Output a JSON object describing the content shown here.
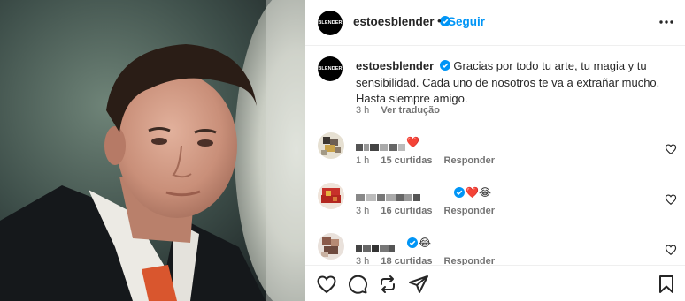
{
  "post": {
    "username": "estoesblender",
    "avatar_text": "BLENDER",
    "follow_label": "Seguir",
    "separator": "•",
    "verified": true
  },
  "caption": {
    "username": "estoesblender",
    "text": "Gracias por todo tu arte, tu magia y tu sensibilidad. Cada uno de nosotros te va a extrañar mucho. Hasta siempre amigo.",
    "time": "3 h",
    "translate_label": "Ver tradução"
  },
  "comments": [
    {
      "time": "1 h",
      "likes": "15 curtidas",
      "reply": "Responder",
      "emojis": "❤️",
      "verified": false
    },
    {
      "time": "3 h",
      "likes": "16 curtidas",
      "reply": "Responder",
      "emojis": "❤️😂",
      "verified": true
    },
    {
      "time": "3 h",
      "likes": "18 curtidas",
      "reply": "Responder",
      "emojis": "😂",
      "verified": true
    }
  ],
  "colors": {
    "accent": "#0095f6",
    "text": "#262626",
    "muted": "#737373",
    "heart": "#ff3040"
  },
  "icons": {
    "verified": "verified-badge-icon",
    "more": "more-options-icon",
    "like": "heart-icon",
    "comment": "comment-icon",
    "share": "share-icon",
    "repost": "repost-icon",
    "save": "bookmark-icon"
  }
}
